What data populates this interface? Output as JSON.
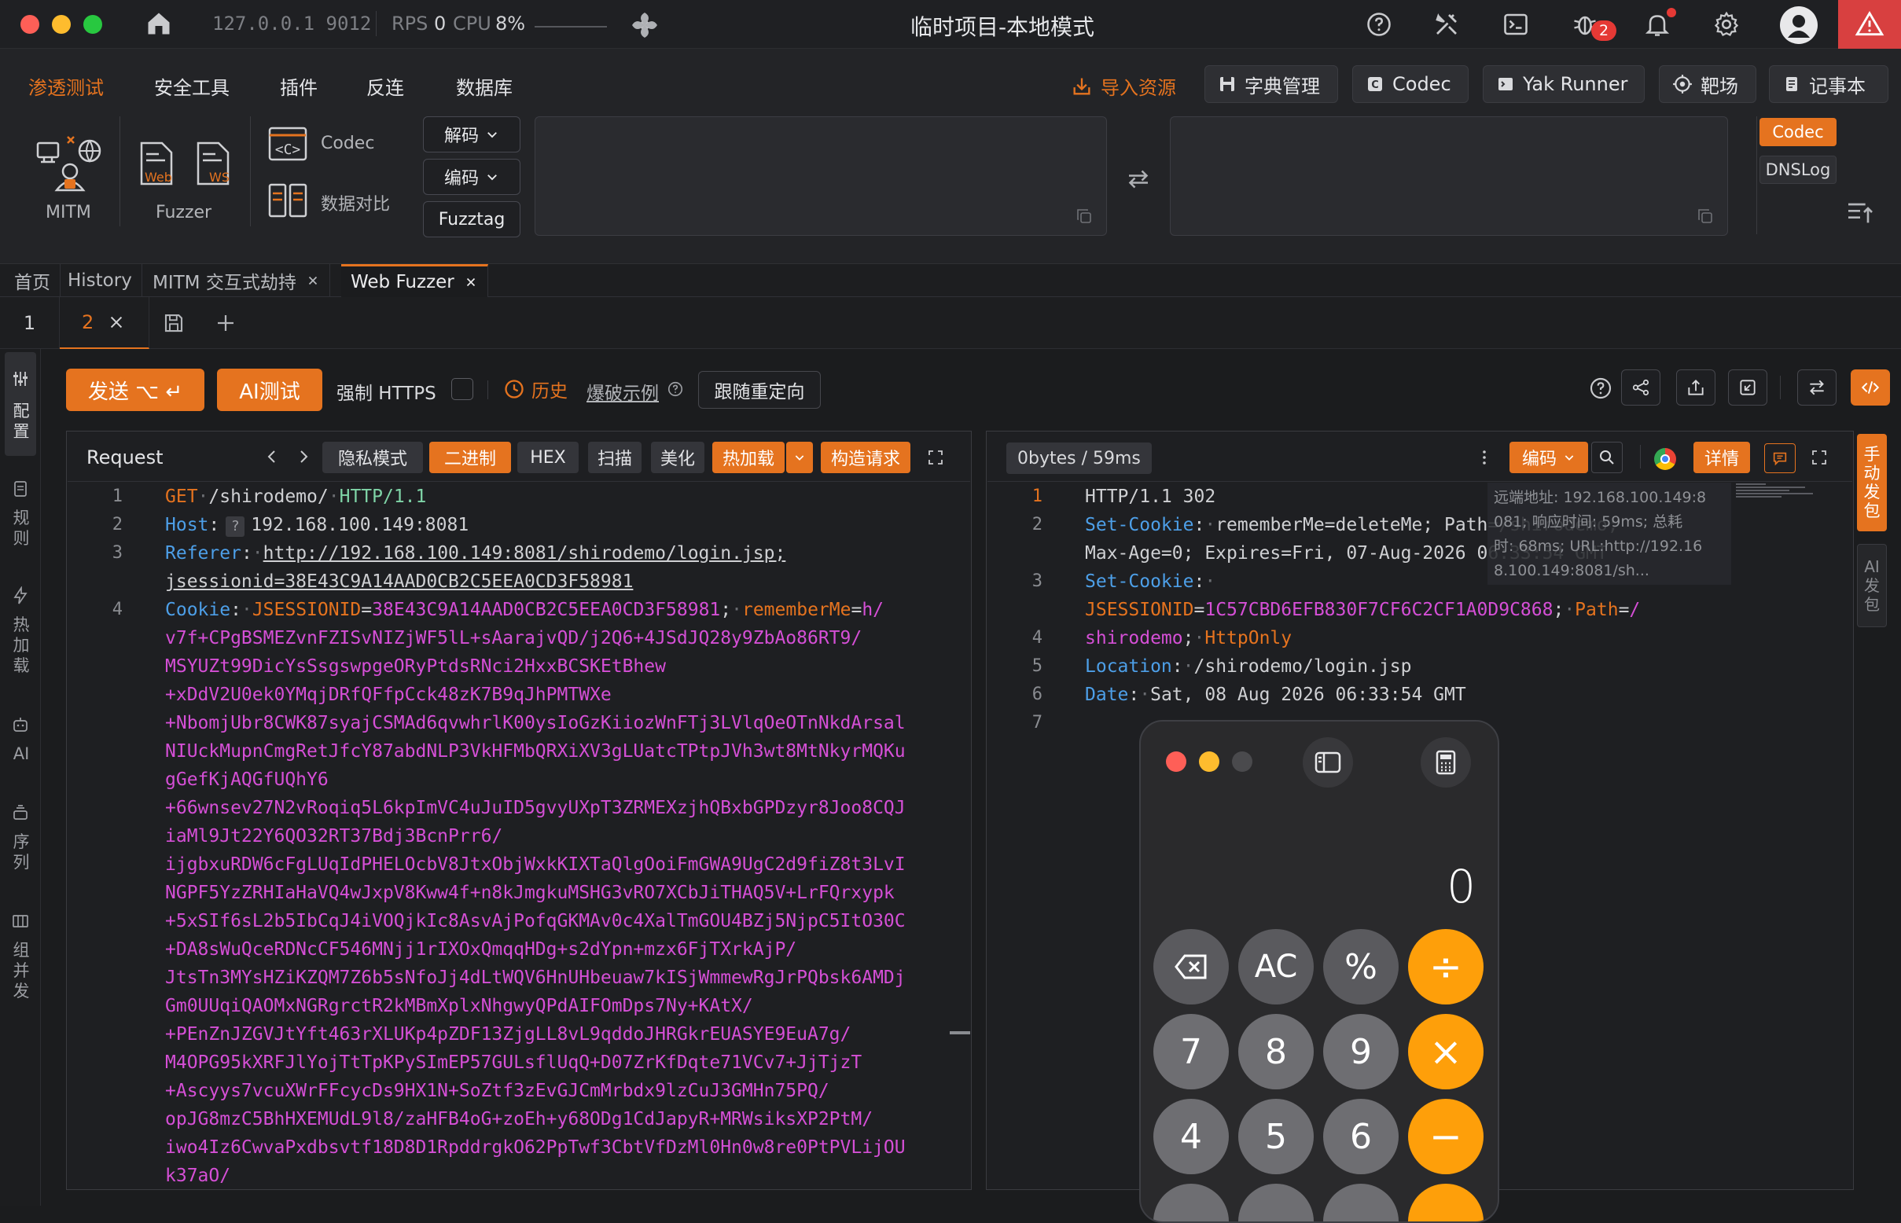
{
  "titlebar": {
    "address": "127.0.0.1 9012",
    "rps_label": "RPS",
    "rps_value": "0",
    "cpu_label": "CPU",
    "cpu_value": "8%",
    "title": "临时项目-本地模式",
    "notif_badge": "2"
  },
  "menu": {
    "tabs": [
      "渗透测试",
      "安全工具",
      "插件",
      "反连",
      "数据库"
    ],
    "active_tab": 0,
    "import_label": "导入资源",
    "buttons": [
      "字典管理",
      "Codec",
      "Yak Runner",
      "靶场",
      "记事本"
    ],
    "tools": {
      "mitm": "MITM",
      "fuzzer": "Fuzzer",
      "web_badge": "Web",
      "ws_badge": "WS",
      "codec": "Codec",
      "diff": "数据对比"
    },
    "codec_selects": [
      "解码",
      "编码",
      "Fuzztag"
    ],
    "right_tabs": [
      "Codec",
      "DNSLog"
    ]
  },
  "page_tabs": [
    {
      "label": "首页",
      "closable": false
    },
    {
      "label": "History",
      "closable": false
    },
    {
      "label": "MITM 交互式劫持",
      "closable": true
    },
    {
      "label": "Web Fuzzer",
      "closable": true
    }
  ],
  "sub_tabs": [
    "1",
    "2"
  ],
  "sidebar": [
    "配置",
    "规则",
    "热加载",
    "AI",
    "序列",
    "组并发"
  ],
  "actionbar": {
    "send": "发送 ⌥ ↵",
    "ai_test": "AI测试",
    "force_https": "强制 HTTPS",
    "history": "历史",
    "example": "爆破示例",
    "follow_redirect": "跟随重定向"
  },
  "request": {
    "title": "Request",
    "chips": [
      "隐私模式",
      "二进制",
      "HEX",
      "扫描",
      "美化",
      "热加载",
      "构造请求"
    ],
    "line_numbers": [
      "1",
      "2",
      "3",
      "4"
    ],
    "method": "GET",
    "path": "/shirodemo/",
    "version": "HTTP/1.1",
    "host_key": "Host",
    "host_val": "192.168.100.149:8081",
    "referer_key": "Referer",
    "referer_val1": "http://192.168.100.149:8081/shirodemo/login.jsp;",
    "referer_val2": "jsessionid=38E43C9A14AAD0CB2C5EEA0CD3F58981",
    "cookie_key": "Cookie",
    "cookie_jsid_key": "JSESSIONID",
    "cookie_jsid_val": "38E43C9A14AAD0CB2C5EEA0CD3F58981",
    "cookie_rm_key": "rememberMe",
    "cookie_rm_first": "h/",
    "cookie_lines": [
      "v7f+CPgBSMEZvnFZISvNIZjWF5lL+sAarajvQD/j2Q6+4JSdJQ28y9ZbAo86RT9/",
      "MSYUZt99DicYsSsgswpgeORyPtdsRNci2HxxBCSKEtBhew",
      "+xDdV2U0ek0YMqjDRfQFfpCck48zK7B9qJhPMTWXe",
      "+NbomjUbr8CWK87syajCSMAd6qvwhrlK00ysIoGzKiiozWnFTj3LVlqOeOTnNkdArsal",
      "NIUckMupnCmgRetJfcY87abdNLP3VkHFMbQRXiXV3gLUatcTPtpJVh3wt8MtNkyrMQKu",
      "gGefKjAQGfUQhY6",
      "+66wnsev27N2vRoqiq5L6kpImVC4uJuID5gvyUXpT3ZRMEXzjhQBxbGPDzyr8Joo8CQJ",
      "iaMl9Jt22Y6QO32RT37Bdj3BcnPrr6/",
      "ijgbxuRDW6cFgLUqIdPHELOcbV8JtxObjWxkKIXTaQlgOoiFmGWA9UgC2d9fiZ8t3LvI",
      "NGPF5YzZRHIaHaVQ4wJxpV8Kww4f+n8kJmgkuMSHG3vRO7XCbJiTHAQ5V+LrFQrxypk",
      "+5xSIf6sL2b5IbCqJ4iVOQjkIc8AsvAjPofqGKMAv0c4XalTmGOU4BZj5NjpC5ItO30C",
      "+DA8sWuQceRDNcCF546MNjj1rIXOxQmqqHDg+s2dYpn+mzx6FjTXrkAjP/",
      "JtsTn3MYsHZiKZQM7Z6b5sNfoJj4dLtWQV6HnUHbeuaw7kISjWmmewRgJrPQbsk6AMDj",
      "Gm0UUqiQAOMxNGRgrctR2kMBmXplxNhgwyQPdAIFOmDps7Ny+KAtX/",
      "+PEnZnJZGVJtYft463rXLUKp4pZDF13ZjgLL8vL9qddoJHRGkrEUASYE9EuA7g/",
      "M4OPG95kXRFJlYojTtTpKPySImEP57GULsflUqQ+D07ZrKfDqte71VCv7+JjTjzT",
      "+Ascyys7vcuXWrFFcycDs9HX1N+SoZtf3zEvGJCmMrbdx9lzCuJ3GMHn75PQ/",
      "opJG8mzC5BhHXEMUdL9l8/zaHFB4oG+zoEh+y68ODg1CdJapyR+MRWsiksXP2PtM/",
      "iwo4Iz6CwvaPxdbsvtf18D8D1RpddrgkO62PpTwf3CbtVfDzMl0Hn0w8re0PtPVLijOU",
      "k37aO/"
    ]
  },
  "response": {
    "status_chip": "0bytes / 59ms",
    "encode": "编码",
    "detail": "详情",
    "line_numbers": [
      "1",
      "2",
      "3",
      "4",
      "5",
      "6",
      "7"
    ],
    "status_line": "HTTP/1.1 302",
    "sc1_key": "Set-Cookie",
    "sc1_val": "rememberMe=deleteMe; Path=/shirodemo;",
    "sc1_val2": "Max-Age=0; Expires=Fri, 07-Aug-2026 06:33:54 GMT",
    "sc2_key": "Set-Cookie",
    "sc2_jsid": "JSESSIONID",
    "sc2_jsid_val": "1C57CBD6EFB830F7CF6C2CF1A0D9C868",
    "sc2_path_key": "Path",
    "sc2_path_val": "/",
    "sc2_line2": "shirodemo",
    "sc2_httponly": "HttpOnly",
    "loc_key": "Location",
    "loc_val": "/shirodemo/login.jsp",
    "date_key": "Date",
    "date_val": "Sat, 08 Aug 2026 06:33:54 GMT",
    "overlay": [
      "远端地址: 192.168.100.149:8",
      "081; 响应时间: 59ms; 总耗",
      "时: 68ms; URL:http://192.16",
      "8.100.149:8081/sh..."
    ],
    "right_tabs": [
      "手动发包",
      "AI发包"
    ]
  },
  "calculator": {
    "display": "0",
    "row1": [
      "⌫",
      "AC",
      "%",
      "÷"
    ],
    "row2": [
      "7",
      "8",
      "9",
      "×"
    ],
    "row3": [
      "4",
      "5",
      "6",
      "−"
    ]
  }
}
